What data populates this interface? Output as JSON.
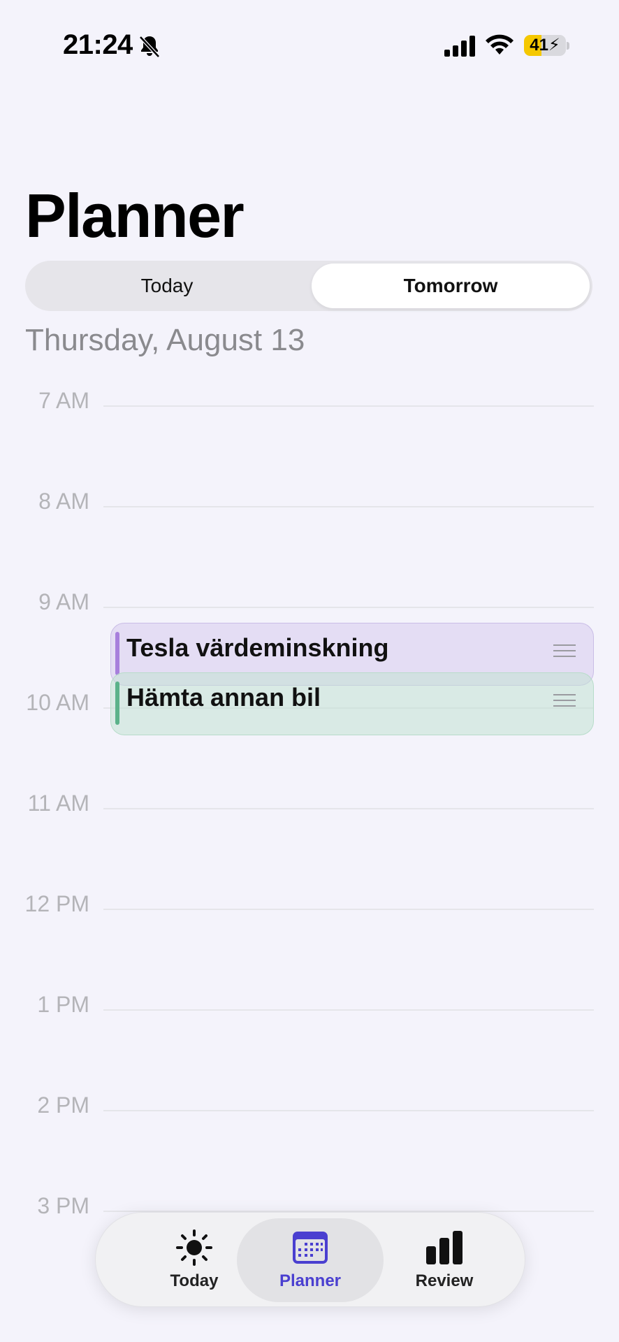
{
  "status_bar": {
    "time": "21:24",
    "battery": "41",
    "battery_level": 0.41
  },
  "header": {
    "title": "Planner"
  },
  "segmented": {
    "options": [
      {
        "label": "Today",
        "selected": false
      },
      {
        "label": "Tomorrow",
        "selected": true
      }
    ]
  },
  "date_heading": "Thursday, August 13",
  "timeline": {
    "hours": [
      "7 AM",
      "8 AM",
      "9 AM",
      "10 AM",
      "11 AM",
      "12 PM",
      "1 PM",
      "2 PM",
      "3 PM"
    ]
  },
  "events": [
    {
      "title": "Tesla värdeminskning",
      "color": "#a77fdc"
    },
    {
      "title": "Hämta annan bil",
      "color": "#5bb28a"
    }
  ],
  "tab_bar": {
    "tabs": [
      {
        "label": "Today",
        "icon": "sun-icon"
      },
      {
        "label": "Planner",
        "icon": "calendar-icon",
        "active": true
      },
      {
        "label": "Review",
        "icon": "bar-chart-icon"
      }
    ]
  },
  "colors": {
    "background": "#f4f3fb",
    "accent": "#4a3fd0"
  }
}
